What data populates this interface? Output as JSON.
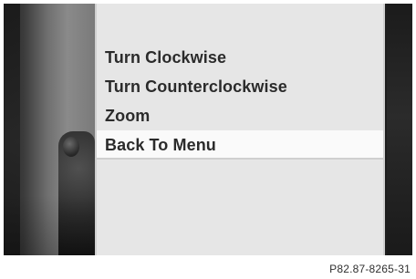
{
  "menu": {
    "items": [
      {
        "label": "Turn Clockwise"
      },
      {
        "label": "Turn Counterclockwise"
      },
      {
        "label": "Zoom"
      },
      {
        "label": "Back To Menu"
      }
    ],
    "selected_index": 3
  },
  "figure_code": "P82.87-8265-31"
}
